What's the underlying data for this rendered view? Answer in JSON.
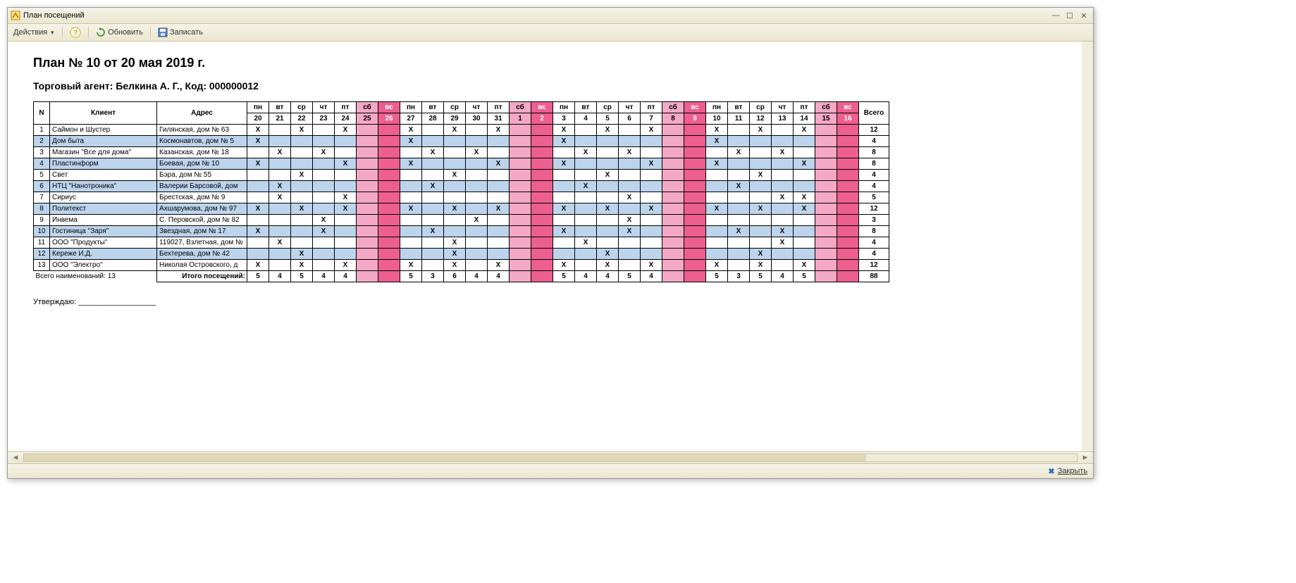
{
  "window": {
    "title": "План посещений"
  },
  "toolbar": {
    "actions": "Действия",
    "refresh": "Обновить",
    "write": "Записать"
  },
  "doc": {
    "title": "План № 10 от 20 мая 2019 г.",
    "subtitle": "Торговый агент: Белкина А. Г., Код: 000000012",
    "headers": {
      "n": "N",
      "client": "Клиент",
      "address": "Адрес",
      "total": "Всего"
    },
    "dow": [
      "пн",
      "вт",
      "ср",
      "чт",
      "пт",
      "сб",
      "вс",
      "пн",
      "вт",
      "ср",
      "чт",
      "пт",
      "сб",
      "вс",
      "пн",
      "вт",
      "ср",
      "чт",
      "пт",
      "сб",
      "вс",
      "пн",
      "вт",
      "ср",
      "чт",
      "пт",
      "сб",
      "вс"
    ],
    "days": [
      "20",
      "21",
      "22",
      "23",
      "24",
      "25",
      "26",
      "27",
      "28",
      "29",
      "30",
      "31",
      "1",
      "2",
      "3",
      "4",
      "5",
      "6",
      "7",
      "8",
      "9",
      "10",
      "11",
      "12",
      "13",
      "14",
      "15",
      "16"
    ],
    "weekend_idx": [
      5,
      6,
      12,
      13,
      19,
      20,
      26,
      27
    ],
    "rows": [
      {
        "n": "1",
        "client": "Саймон и Шустер",
        "addr": "Гилянская, дом № 63",
        "v": [
          "X",
          "",
          "X",
          "",
          "X",
          "",
          "",
          "X",
          "",
          "X",
          "",
          "X",
          "",
          "",
          "X",
          "",
          "X",
          "",
          "X",
          "",
          "",
          "X",
          "",
          "X",
          "",
          "X",
          "",
          ""
        ],
        "tot": "12"
      },
      {
        "n": "2",
        "client": "Дом быта",
        "addr": "Космонавтов, дом № 5",
        "v": [
          "X",
          "",
          "",
          "",
          "",
          "",
          "",
          "X",
          "",
          "",
          "",
          "",
          "",
          "",
          "X",
          "",
          "",
          "",
          "",
          "",
          "",
          "X",
          "",
          "",
          "",
          "",
          "",
          ""
        ],
        "tot": "4"
      },
      {
        "n": "3",
        "client": "Магазин \"Все для дома\"",
        "addr": "Казанская, дом № 18",
        "v": [
          "",
          "X",
          "",
          "X",
          "",
          "",
          "",
          "",
          "X",
          "",
          "X",
          "",
          "",
          "",
          "",
          "X",
          "",
          "X",
          "",
          "",
          "",
          "",
          "X",
          "",
          "X",
          "",
          "",
          ""
        ],
        "tot": "8"
      },
      {
        "n": "4",
        "client": "Пластинформ",
        "addr": "Боевая, дом № 10",
        "v": [
          "X",
          "",
          "",
          "",
          "X",
          "",
          "",
          "X",
          "",
          "",
          "",
          "X",
          "",
          "",
          "X",
          "",
          "",
          "",
          "X",
          "",
          "",
          "X",
          "",
          "",
          "",
          "X",
          "",
          ""
        ],
        "tot": "8"
      },
      {
        "n": "5",
        "client": "Свет",
        "addr": "Бэра, дом № 55",
        "v": [
          "",
          "",
          "X",
          "",
          "",
          "",
          "",
          "",
          "",
          "X",
          "",
          "",
          "",
          "",
          "",
          "",
          "X",
          "",
          "",
          "",
          "",
          "",
          "",
          "X",
          "",
          "",
          "",
          ""
        ],
        "tot": "4"
      },
      {
        "n": "6",
        "client": "НТЦ \"Нанотроника\"",
        "addr": "Валерии Барсовой, дом",
        "v": [
          "",
          "X",
          "",
          "",
          "",
          "",
          "",
          "",
          "X",
          "",
          "",
          "",
          "",
          "",
          "",
          "X",
          "",
          "",
          "",
          "",
          "",
          "",
          "X",
          "",
          "",
          "",
          "",
          ""
        ],
        "tot": "4"
      },
      {
        "n": "7",
        "client": "Сириус",
        "addr": "Брестская, дом № 9",
        "v": [
          "",
          "X",
          "",
          "",
          "X",
          "",
          "",
          "",
          "",
          "",
          "",
          "",
          "",
          "",
          "",
          "",
          "",
          "X",
          "",
          "",
          "",
          "",
          "",
          "",
          "X",
          "X",
          "",
          ""
        ],
        "tot": "5"
      },
      {
        "n": "8",
        "client": "Политекст",
        "addr": "Ахшарумова, дом № 97",
        "v": [
          "X",
          "",
          "X",
          "",
          "X",
          "",
          "",
          "X",
          "",
          "X",
          "",
          "X",
          "",
          "",
          "X",
          "",
          "X",
          "",
          "X",
          "",
          "",
          "X",
          "",
          "X",
          "",
          "X",
          "",
          ""
        ],
        "tot": "12"
      },
      {
        "n": "9",
        "client": "Инвема",
        "addr": "С. Перовской, дом № 82",
        "v": [
          "",
          "",
          "",
          "X",
          "",
          "",
          "",
          "",
          "",
          "",
          "X",
          "",
          "",
          "",
          "",
          "",
          "",
          "X",
          "",
          "",
          "",
          "",
          "",
          "",
          "",
          "",
          "",
          ""
        ],
        "tot": "3"
      },
      {
        "n": "10",
        "client": "Гостиница \"Заря\"",
        "addr": "Звездная, дом № 17",
        "v": [
          "X",
          "",
          "",
          "X",
          "",
          "",
          "",
          "",
          "X",
          "",
          "",
          "",
          "",
          "",
          "X",
          "",
          "",
          "X",
          "",
          "",
          "",
          "",
          "X",
          "",
          "X",
          "",
          "",
          ""
        ],
        "tot": "8"
      },
      {
        "n": "11",
        "client": "ООО \"Продукты\"",
        "addr": "119027, Взлетная, дом №",
        "v": [
          "",
          "X",
          "",
          "",
          "",
          "",
          "",
          "",
          "",
          "X",
          "",
          "",
          "",
          "",
          "",
          "X",
          "",
          "",
          "",
          "",
          "",
          "",
          "",
          "",
          "X",
          "",
          "",
          ""
        ],
        "tot": "4"
      },
      {
        "n": "12",
        "client": "Кереже И.Д.",
        "addr": "Бехтерева, дом № 42",
        "v": [
          "",
          "",
          "X",
          "",
          "",
          "",
          "",
          "",
          "",
          "X",
          "",
          "",
          "",
          "",
          "",
          "",
          "X",
          "",
          "",
          "",
          "",
          "",
          "",
          "X",
          "",
          "",
          "",
          ""
        ],
        "tot": "4"
      },
      {
        "n": "13",
        "client": "ООО \"Электро\"",
        "addr": "Николая Островского, д",
        "v": [
          "X",
          "",
          "X",
          "",
          "X",
          "",
          "",
          "X",
          "",
          "X",
          "",
          "X",
          "",
          "",
          "X",
          "",
          "X",
          "",
          "X",
          "",
          "",
          "X",
          "",
          "X",
          "",
          "X",
          "",
          ""
        ],
        "tot": "12"
      }
    ],
    "total_names_label": "Всего наименований: 13",
    "total_visits_label": "Итого посещений:",
    "col_totals": [
      "5",
      "4",
      "5",
      "4",
      "4",
      "",
      "",
      "5",
      "3",
      "6",
      "4",
      "4",
      "",
      "",
      "5",
      "4",
      "4",
      "5",
      "4",
      "",
      "",
      "5",
      "3",
      "5",
      "4",
      "5",
      "",
      ""
    ],
    "grand_total": "88",
    "approve": "Утверждаю: __________________"
  },
  "status": {
    "close": "Закрыть"
  }
}
